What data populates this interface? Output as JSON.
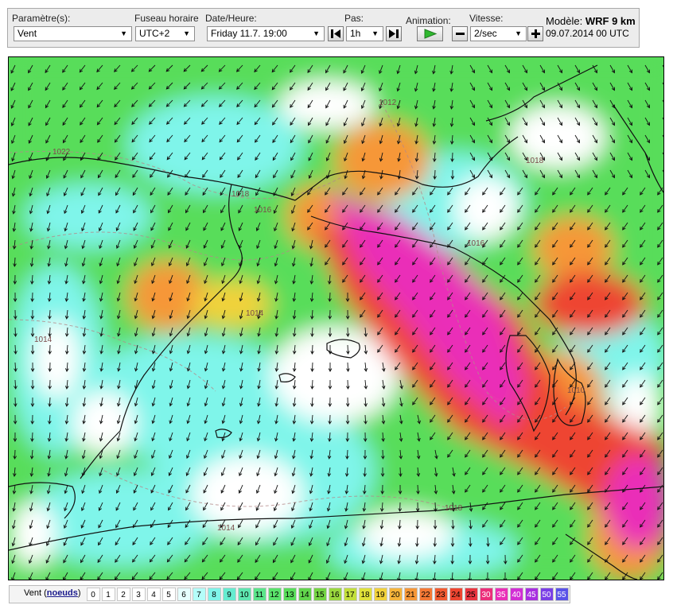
{
  "toolbar": {
    "param_label": "Paramètre(s):",
    "param_value": "Vent",
    "timezone_label": "Fuseau horaire",
    "timezone_value": "UTC+2",
    "datetime_label": "Date/Heure:",
    "datetime_value": "Friday 11.7. 19:00",
    "step_label": "Pas:",
    "step_value": "1h",
    "animation_label": "Animation:",
    "speed_label": "Vitesse:",
    "speed_value": "2/sec",
    "model_prefix": "Modèle:",
    "model_name": "WRF 9 km",
    "model_run": "09.07.2014 00 UTC"
  },
  "icons": [
    "step-back-icon",
    "play-icon",
    "step-forward-icon",
    "minus-icon",
    "plus-icon",
    "dropdown-arrow-icon"
  ],
  "map": {
    "isobar_labels": [
      "1012",
      "1022",
      "1018",
      "1016",
      "1018",
      "1014",
      "1014",
      "1010",
      "1016",
      "1014",
      "1018"
    ]
  },
  "legend": {
    "label": "Vent (",
    "unit_link": "noeuds",
    "label_end": ")",
    "values": [
      "0",
      "1",
      "2",
      "3",
      "4",
      "5",
      "6",
      "7",
      "8",
      "9",
      "10",
      "11",
      "12",
      "13",
      "14",
      "15",
      "16",
      "17",
      "18",
      "19",
      "20",
      "21",
      "22",
      "23",
      "24",
      "25",
      "30",
      "35",
      "40",
      "45",
      "50",
      "55"
    ],
    "colors": [
      "#ffffff",
      "#ffffff",
      "#ffffff",
      "#ffffff",
      "#ffffff",
      "#ffffff",
      "#e6fffe",
      "#b4fdf9",
      "#7ff5ea",
      "#66ecd0",
      "#5ee6b0",
      "#5be58a",
      "#59e26a",
      "#58dd5a",
      "#61d54c",
      "#74d443",
      "#9ad83e",
      "#c2df3a",
      "#e0e23a",
      "#f2d23a",
      "#f6b43a",
      "#f69738",
      "#f57834",
      "#f25a30",
      "#ee4530",
      "#ea3540",
      "#ec2e7a",
      "#ea2eb8",
      "#d22ed4",
      "#a82ee0",
      "#7a3ee6",
      "#5a52e8"
    ]
  },
  "colors": {
    "low_wind": "#ffffff",
    "light_wind": "#7ff5ea",
    "moderate_wind": "#58dd5a",
    "fresh_wind": "#f2d23a",
    "strong_wind": "#ee4530",
    "gale_wind": "#ea2eb8",
    "toolbar_bg": "#ececec",
    "play_green": "#2eb82e"
  }
}
